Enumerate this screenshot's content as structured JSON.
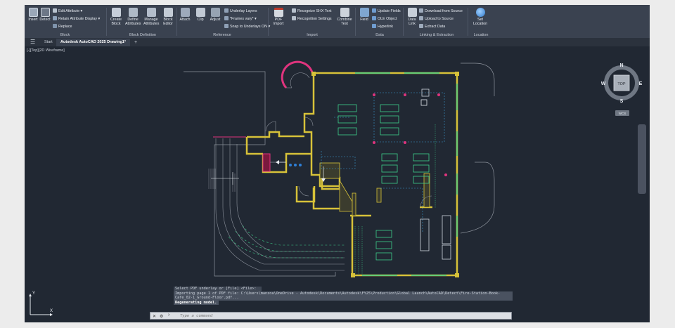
{
  "ribbon": {
    "block_panel": {
      "insert": "Insert",
      "detect": "Detect",
      "edit_attribute": "Edit Attribute",
      "retain_attribute_display": "Retain Attribute Display",
      "replace": "Replace",
      "label": "Block"
    },
    "block_definition_panel": {
      "create_block": "Create Block",
      "define_attributes": "Define Attributes",
      "manage_attributes": "Manage Attributes",
      "block_editor": "Block Editor",
      "label": "Block Definition"
    },
    "reference_panel": {
      "attach": "Attach",
      "clip": "Clip",
      "adjust": "Adjust",
      "underlay_layers": "Underlay Layers",
      "frames_vary": "*Frames vary*",
      "snap_to_underlays": "Snap to Underlays ON",
      "label": "Reference"
    },
    "import_panel": {
      "pdf_import": "PDF Import",
      "recognize_shx_text": "Recognize SHX Text",
      "recognition_settings": "Recognition Settings",
      "combine_text": "Combine Text",
      "label": "Import"
    },
    "data_panel": {
      "field": "Field",
      "update_fields": "Update Fields",
      "ole_object": "OLE Object",
      "hyperlink": "Hyperlink",
      "label": "Data"
    },
    "linking_panel": {
      "data_link": "Data Link",
      "download_from_source": "Download from Source",
      "upload_to_source": "Upload to Source",
      "extract_data": "Extract Data",
      "label": "Linking & Extraction"
    },
    "location_panel": {
      "set_location": "Set Location",
      "label": "Location"
    }
  },
  "tabs": {
    "start": "Start",
    "drawing": "Autodesk AutoCAD 2025 Drawing1*",
    "plus": "+"
  },
  "viewport": {
    "view_label": "[-][Top][2D Wireframe]"
  },
  "viewcube": {
    "n": "N",
    "s": "S",
    "e": "E",
    "w": "W",
    "top": "TOP",
    "wcs": "WCS"
  },
  "ucs": {
    "x": "X",
    "y": "Y"
  },
  "command": {
    "history": [
      "Select PDF underlay or [File] <File>:",
      "Importing page 1 of PDF file: C:\\Users\\manzoa\\OneDrive - Autodesk\\Documents\\Autodesk\\FY25\\Production\\Global Launch\\AutoCAD\\Detect\\Fire-Station-Book-",
      "Cafe_02-1_Ground-Floor.pdf...",
      "Regenerating model."
    ],
    "placeholder": "Type a command"
  },
  "colors": {
    "background": "#212833",
    "wall": "#d7c239",
    "wall_dark": "#5a5f38",
    "furniture": "#3ed08b",
    "dashed": "#3a9ad0",
    "accent_magenta": "#e0347e",
    "outline": "#8c929c"
  }
}
